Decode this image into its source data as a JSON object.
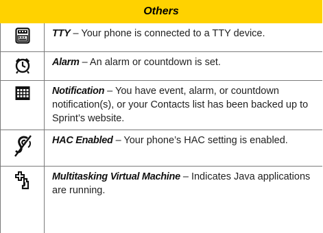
{
  "header": {
    "title": "Others"
  },
  "rows": [
    {
      "icon": "tty-icon",
      "term": "TTY",
      "desc": " – Your phone is connected to a TTY device."
    },
    {
      "icon": "alarm-clock-icon",
      "term": "Alarm",
      "desc": " – An alarm or countdown is set."
    },
    {
      "icon": "calendar-icon",
      "term": "Notification",
      "desc": " – You have event, alarm, or countdown notification(s), or your Contacts list has been backed up to Sprint’s website."
    },
    {
      "icon": "hearing-aid-icon",
      "term": "HAC Enabled",
      "desc": " – Your phone’s HAC setting is enabled."
    },
    {
      "icon": "java-cup-icon",
      "term": "Multitasking Virtual Machine",
      "desc": " – Indicates Java applications are running."
    }
  ]
}
